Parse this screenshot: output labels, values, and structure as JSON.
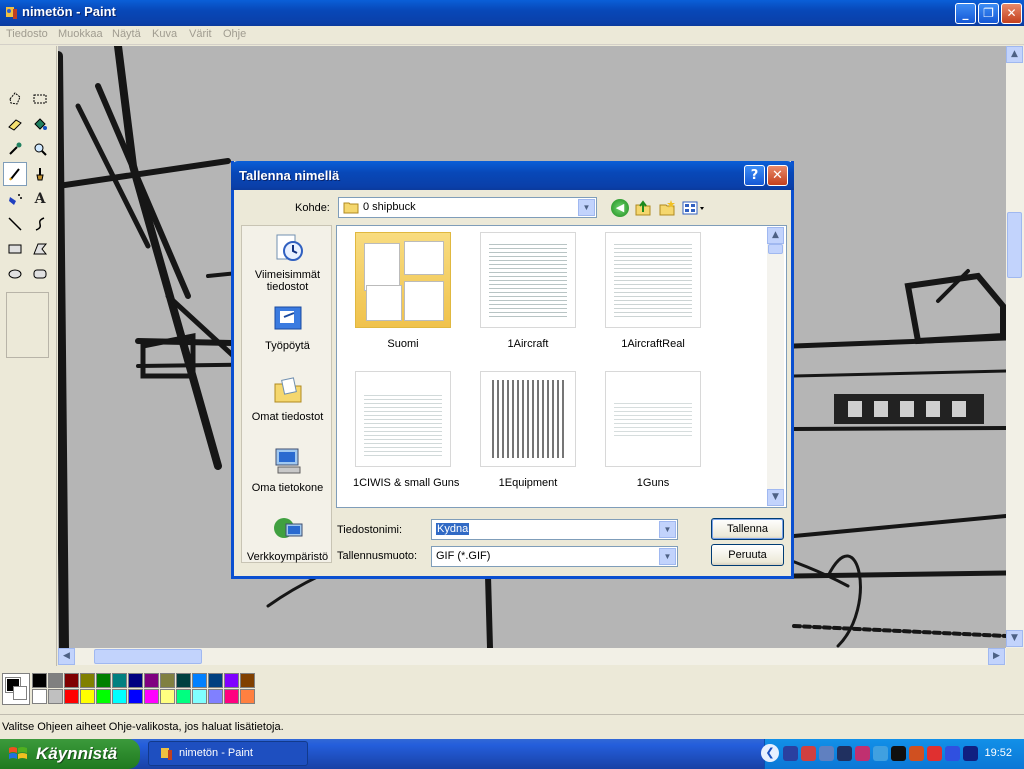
{
  "window": {
    "title": "nimetön - Paint",
    "minimize": "_",
    "maximize": "❐",
    "close": "✕"
  },
  "menu": [
    "Tiedosto",
    "Muokkaa",
    "Näytä",
    "Kuva",
    "Värit",
    "Ohje"
  ],
  "toolbox": {
    "tools": [
      "free-select",
      "rect-select",
      "eraser",
      "fill",
      "color-picker",
      "magnifier",
      "pencil",
      "brush",
      "airbrush",
      "text",
      "line",
      "curve",
      "rectangle",
      "polygon",
      "ellipse",
      "rounded-rect"
    ],
    "selected": "pencil"
  },
  "palette": {
    "foreground": "#000000",
    "background": "#ffffff",
    "row1": [
      "#000000",
      "#808080",
      "#800000",
      "#808000",
      "#008000",
      "#008080",
      "#000080",
      "#800080",
      "#808040",
      "#004040",
      "#0080ff",
      "#004080",
      "#8000ff",
      "#804000"
    ],
    "row2": [
      "#ffffff",
      "#c0c0c0",
      "#ff0000",
      "#ffff00",
      "#00ff00",
      "#00ffff",
      "#0000ff",
      "#ff00ff",
      "#ffff80",
      "#00ff80",
      "#80ffff",
      "#8080ff",
      "#ff0080",
      "#ff8040"
    ]
  },
  "status": {
    "text": "Valitse Ohjeen aiheet Ohje-valikosta, jos haluat lisätietoja."
  },
  "taskbar": {
    "start_label": "Käynnistä",
    "task_label": "nimetön - Paint",
    "clock": "19:52"
  },
  "dialog": {
    "title": "Tallenna nimellä",
    "help": "?",
    "close": "✕",
    "location_label": "Kohde:",
    "location_value": "0 shipbuck",
    "places": [
      "Viimeisimmät tiedostot",
      "Työpöytä",
      "Omat tiedostot",
      "Oma tietokone",
      "Verkkoympäristö"
    ],
    "files": [
      "Suomi",
      "1Aircraft",
      "1AircraftReal",
      "1CIWIS & small Guns",
      "1Equipment",
      "1Guns"
    ],
    "filename_label": "Tiedostonimi:",
    "filename_value": "Kydna",
    "filetype_label": "Tallennusmuoto:",
    "filetype_value": "GIF (*.GIF)",
    "save_label": "Tallenna",
    "cancel_label": "Peruuta"
  }
}
